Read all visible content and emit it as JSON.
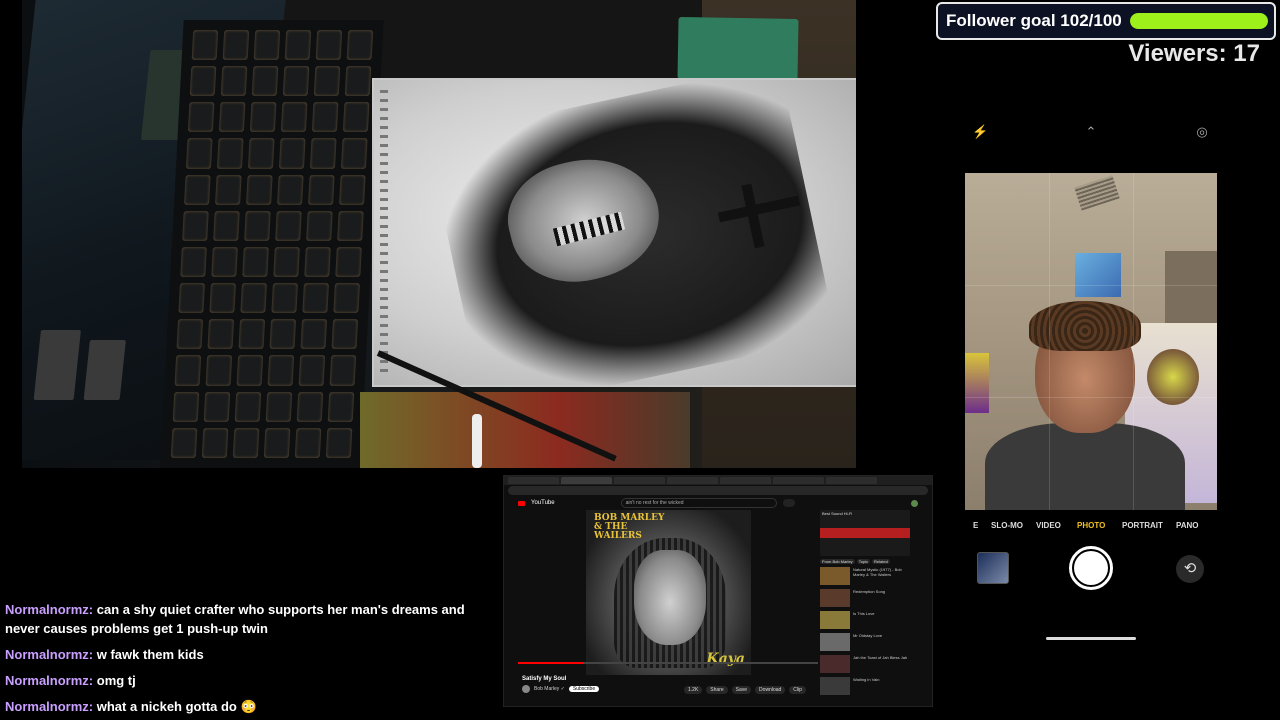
{
  "overlay": {
    "follower_goal_label": "Follower goal 102/100",
    "follower_goal_progress": 1.0,
    "follower_goal_color": "#9ef01a",
    "viewers_label": "Viewers: 17"
  },
  "chat": {
    "messages": [
      {
        "user": "Normalnormz:",
        "text": "can a shy quiet crafter who supports her man's dreams and never causes problems get 1 push-up twin"
      },
      {
        "user": "Normalnormz:",
        "text": "w fawk them kids"
      },
      {
        "user": "Normalnormz:",
        "text": "omg tj"
      },
      {
        "user": "Normalnormz:",
        "text": "what a nickeh gotta do 😳"
      }
    ],
    "user_color": "#c9a0ff"
  },
  "browser": {
    "search_text": "ain't no rest for the wicked",
    "site_name": "YouTube",
    "album_title": "BOB MARLEY & THE WAILERS",
    "album_subtitle": "Kaya",
    "video_title": "Satisfy My Soul",
    "channel_name": "Bob Marley ✓",
    "subscribe_label": "Subscribe",
    "actions": [
      "1.2K",
      "Share",
      "Save",
      "Download",
      "Clip"
    ],
    "progress": 0.22,
    "sidebar_ad_title": "Best Sound Hi-Fi",
    "chips": [
      "From Bob Marley",
      "Topic",
      "Related"
    ],
    "recommended": [
      {
        "title": "Natural Mystic (1977) - Bob Marley & The Wailers"
      },
      {
        "title": "Redemption Song"
      },
      {
        "title": "Is This Love"
      },
      {
        "title": "Mr Oldstay Love"
      },
      {
        "title": "Jah the Toast of Jah Bless Jah"
      },
      {
        "title": "Waiting In Vain"
      }
    ]
  },
  "phone": {
    "icons": [
      "flash-off-icon",
      "chevron-up-icon",
      "live-photo-icon"
    ],
    "modes": [
      "E",
      "SLO-MO",
      "VIDEO",
      "PHOTO",
      "PORTRAIT",
      "PANO"
    ],
    "active_mode": "PHOTO",
    "active_mode_color": "#f0c020"
  }
}
